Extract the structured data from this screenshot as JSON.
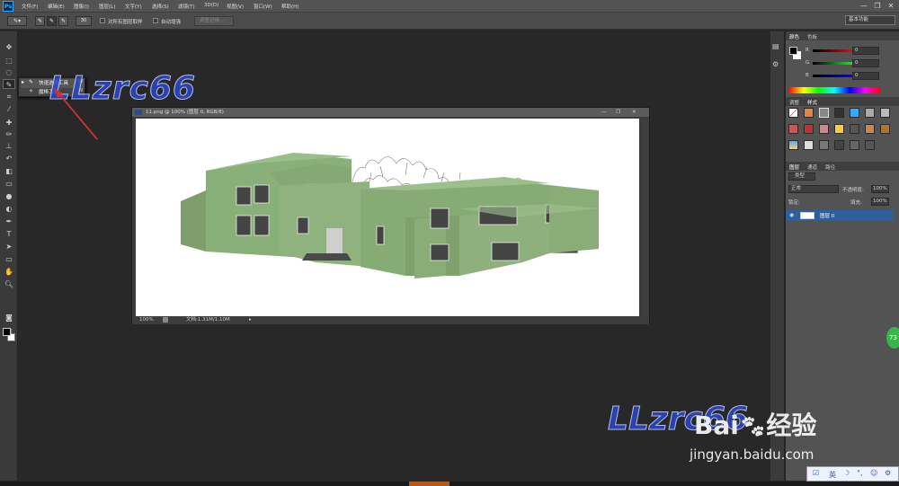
{
  "app": {
    "logo": "Ps"
  },
  "menu": [
    "文件(F)",
    "编辑(E)",
    "图像(I)",
    "图层(L)",
    "文字(Y)",
    "选择(S)",
    "滤镜(T)",
    "3D(D)",
    "视图(V)",
    "窗口(W)",
    "帮助(H)"
  ],
  "window_controls": {
    "minimize": "—",
    "restore": "❐",
    "close": "✕"
  },
  "options_bar": {
    "brush_size": "30",
    "sample_all_layers": "对所有图层取样",
    "auto_enhance": "自动增强",
    "refine_edge": "调整边缘...",
    "workspace": "基本功能"
  },
  "flyout": {
    "items": [
      {
        "label": "快速选择工具",
        "shortcut": "W"
      },
      {
        "label": "魔棒工具",
        "shortcut": "W"
      }
    ]
  },
  "document": {
    "title": "11.png @ 100% (图层 0, RGB/8)",
    "zoom": "100%",
    "doc_size": "文档:1.31M/1.10M"
  },
  "color_panel": {
    "tabs": [
      "颜色",
      "色板"
    ],
    "channels": [
      {
        "label": "R",
        "value": "0",
        "color": "#e03a3a"
      },
      {
        "label": "G",
        "value": "0",
        "color": "#3ac03a"
      },
      {
        "label": "B",
        "value": "0",
        "color": "#3a5ae0"
      }
    ]
  },
  "styles_panel": {
    "tabs": [
      "调整",
      "样式"
    ]
  },
  "layers_panel": {
    "tabs": [
      "图层",
      "通道",
      "路径"
    ],
    "filter": "类型",
    "blend_mode": "正常",
    "opacity_label": "不透明度:",
    "opacity_value": "100%",
    "lock_label": "锁定:",
    "fill_label": "填充:",
    "fill_value": "100%",
    "layers": [
      {
        "name": "图层 0",
        "visible": true
      }
    ]
  },
  "watermark": {
    "top": "LLzrc66",
    "bottom": "LLzrc66"
  },
  "baidu": {
    "logo": "Bai",
    "brand": "经验",
    "url": "jingyan.baidu.com"
  },
  "ime": {
    "lang": "英"
  },
  "badge": {
    "value": "73"
  },
  "colors": {
    "accent": "#31a8ff",
    "ui_bg": "#282828",
    "panel": "#535353",
    "building": "#8ab07a"
  }
}
